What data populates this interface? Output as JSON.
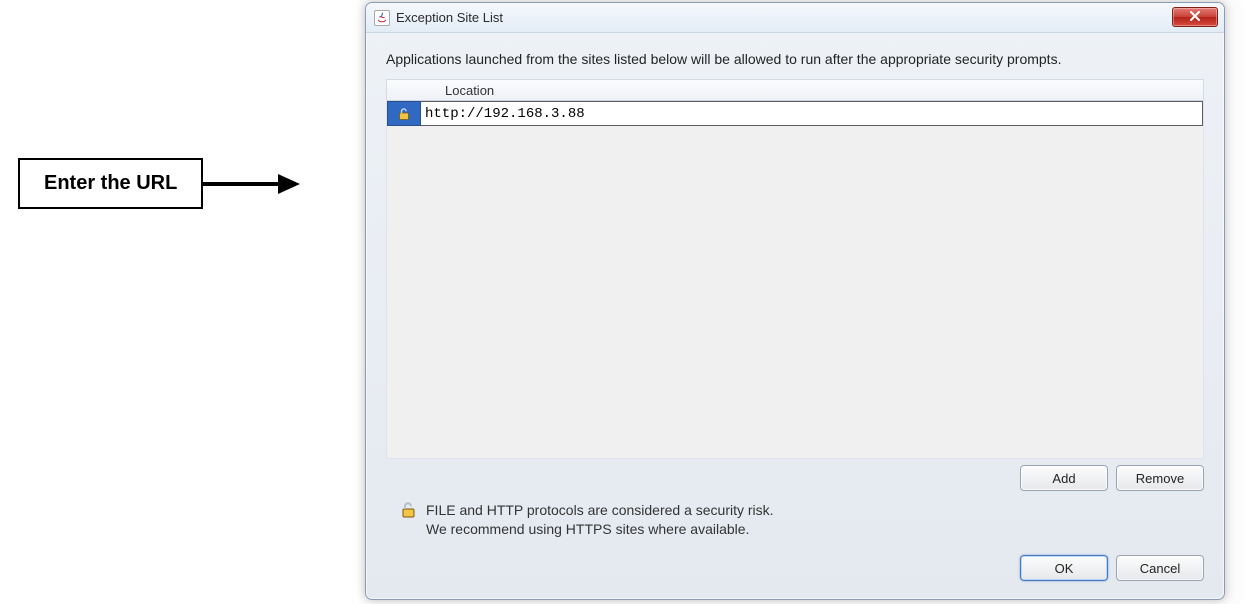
{
  "annotation": {
    "label": "Enter the URL"
  },
  "dialog": {
    "title": "Exception Site List",
    "instruction": "Applications launched from the sites listed below will be allowed to run after the appropriate security prompts.",
    "column_header": "Location",
    "entries": [
      {
        "url": "http://192.168.3.88"
      }
    ],
    "warning_line1": "FILE and HTTP protocols are considered a security risk.",
    "warning_line2": "We recommend using HTTPS sites where available.",
    "buttons": {
      "add": "Add",
      "remove": "Remove",
      "ok": "OK",
      "cancel": "Cancel"
    }
  }
}
